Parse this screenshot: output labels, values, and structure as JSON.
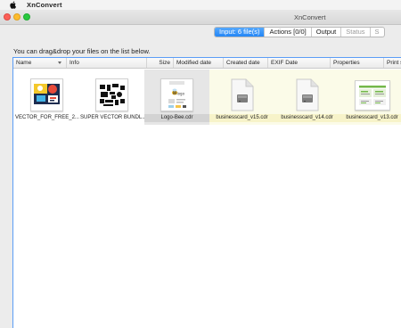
{
  "menubar": {
    "app_name": "XnConvert"
  },
  "window": {
    "title": "XnConvert"
  },
  "tabs": [
    {
      "label": "Input: 6 file(s)",
      "active": true
    },
    {
      "label": "Actions [0/0]"
    },
    {
      "label": "Output"
    },
    {
      "label": "Status",
      "disabled": true
    },
    {
      "label": "S",
      "disabled": true
    }
  ],
  "hint": "You can drag&drop your files on the list below.",
  "columns": {
    "name": "Name",
    "info": "Info",
    "size": "Size",
    "modified": "Modified date",
    "created": "Created date",
    "exif": "EXIF Date",
    "properties": "Properties",
    "print": "Print s"
  },
  "files": [
    {
      "name": "VECTOR_FOR_FREE_2...",
      "thumb": "colorful-vector-thumbnail"
    },
    {
      "name": "SUPER VECTOR BUNDL...",
      "thumb": "black-vector-thumbnail"
    },
    {
      "name": "Logo-Bee.cdr",
      "thumb": "logo-bee-thumbnail"
    },
    {
      "name": "businesscard_v15.cdr",
      "thumb": "generic-document-icon"
    },
    {
      "name": "businesscard_v14.cdr",
      "thumb": "generic-document-icon"
    },
    {
      "name": "businesscard_v13.cdr",
      "thumb": "businesscard-thumbnail"
    }
  ],
  "colors": {
    "accent": "#2386f6",
    "close": "#fc5f57",
    "minimize": "#fdbc2e",
    "maximize": "#29c940",
    "selection_label": "#f7f3c9"
  }
}
